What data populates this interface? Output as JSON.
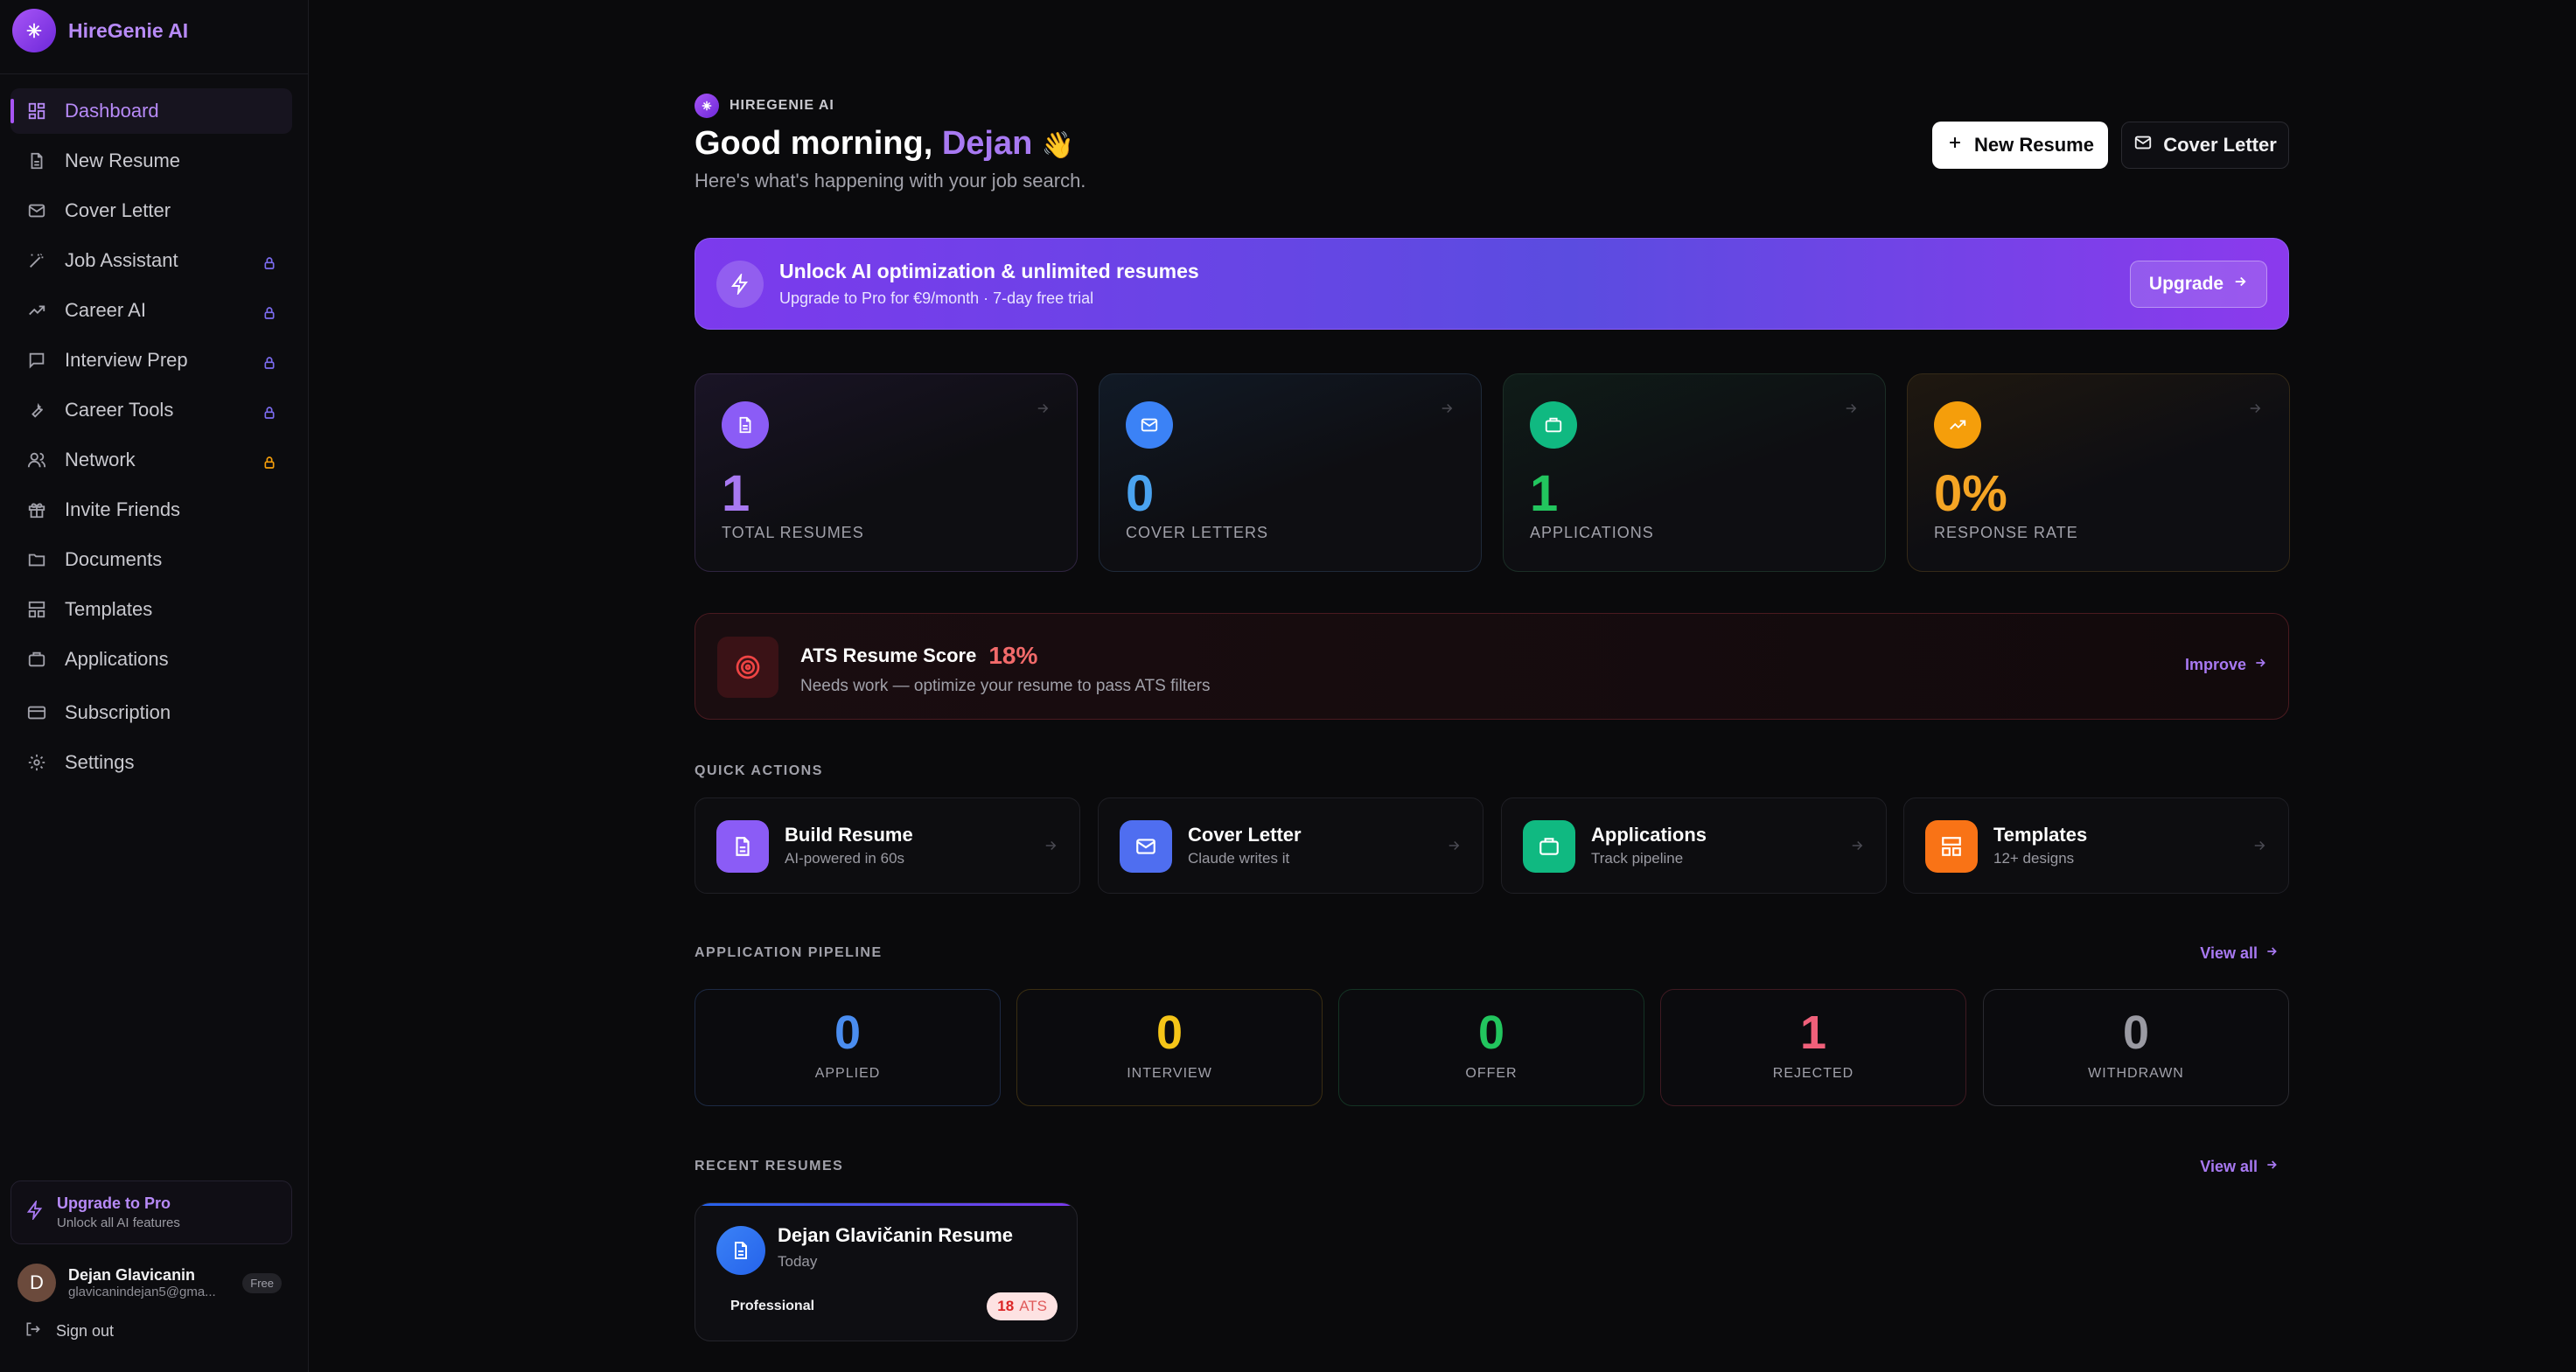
{
  "app": {
    "name": "HireGenie AI",
    "brand_caps": "HIREGENIE AI"
  },
  "sidebar": {
    "items": [
      {
        "label": "Dashboard",
        "icon": "grid-icon",
        "active": true
      },
      {
        "label": "New Resume",
        "icon": "file-icon"
      },
      {
        "label": "Cover Letter",
        "icon": "mail-icon"
      },
      {
        "label": "Job Assistant",
        "icon": "wand-icon",
        "locked": true
      },
      {
        "label": "Career AI",
        "icon": "trending-icon",
        "locked": true
      },
      {
        "label": "Interview Prep",
        "icon": "chat-icon",
        "locked": true
      },
      {
        "label": "Career Tools",
        "icon": "wrench-icon",
        "locked": true
      },
      {
        "label": "Network",
        "icon": "users-icon",
        "locked": true
      },
      {
        "label": "Invite Friends",
        "icon": "gift-icon"
      },
      {
        "label": "Documents",
        "icon": "folder-icon"
      },
      {
        "label": "Templates",
        "icon": "layout-icon"
      },
      {
        "label": "Applications",
        "icon": "briefcase-icon"
      },
      {
        "label": "Subscription",
        "icon": "card-icon"
      },
      {
        "label": "Settings",
        "icon": "gear-icon"
      }
    ],
    "upgrade": {
      "title": "Upgrade to Pro",
      "subtitle": "Unlock all AI features"
    },
    "user": {
      "initial": "D",
      "name": "Dejan Glavicanin",
      "email": "glavicanindejan5@gma...",
      "plan": "Free"
    },
    "signout": "Sign out"
  },
  "header": {
    "greeting_prefix": "Good morning, ",
    "greeting_name": "Dejan",
    "greeting_emoji": "👋",
    "subtitle": "Here's what's happening with your job search.",
    "new_resume_label": "New Resume",
    "cover_letter_label": "Cover Letter"
  },
  "banner": {
    "title": "Unlock AI optimization & unlimited resumes",
    "subtitle": "Upgrade to Pro for €9/month · 7-day free trial",
    "button": "Upgrade"
  },
  "stats": [
    {
      "value": "1",
      "label": "TOTAL RESUMES",
      "color": "#a879f2",
      "icon": "document-icon"
    },
    {
      "value": "0",
      "label": "COVER LETTERS",
      "color": "#4aa3f0",
      "icon": "mail-icon"
    },
    {
      "value": "1",
      "label": "APPLICATIONS",
      "color": "#22c55e",
      "icon": "briefcase-icon"
    },
    {
      "value": "0%",
      "label": "RESPONSE RATE",
      "color": "#f5a524",
      "icon": "trending-icon"
    }
  ],
  "ats": {
    "title": "ATS Resume Score",
    "score": "18%",
    "subtitle": "Needs work — optimize your resume to pass ATS filters",
    "link": "Improve"
  },
  "quick_actions": {
    "heading": "QUICK ACTIONS",
    "items": [
      {
        "title": "Build Resume",
        "subtitle": "AI-powered in 60s",
        "icon": "document-icon"
      },
      {
        "title": "Cover Letter",
        "subtitle": "Claude writes it",
        "icon": "mail-icon"
      },
      {
        "title": "Applications",
        "subtitle": "Track pipeline",
        "icon": "briefcase-icon"
      },
      {
        "title": "Templates",
        "subtitle": "12+ designs",
        "icon": "layout-icon"
      }
    ]
  },
  "pipeline": {
    "heading": "APPLICATION PIPELINE",
    "view_all": "View all",
    "stages": [
      {
        "value": "0",
        "label": "APPLIED",
        "color": "#4a8df0"
      },
      {
        "value": "0",
        "label": "INTERVIEW",
        "color": "#f5c518"
      },
      {
        "value": "0",
        "label": "OFFER",
        "color": "#22c55e"
      },
      {
        "value": "1",
        "label": "REJECTED",
        "color": "#f0607a"
      },
      {
        "value": "0",
        "label": "WITHDRAWN",
        "color": "#9a9aa2"
      }
    ]
  },
  "recent": {
    "heading": "RECENT RESUMES",
    "view_all": "View all",
    "resume": {
      "title": "Dejan Glavičanin Resume",
      "date": "Today",
      "tag": "Professional",
      "ats_score": "18",
      "ats_label": "ATS"
    }
  }
}
